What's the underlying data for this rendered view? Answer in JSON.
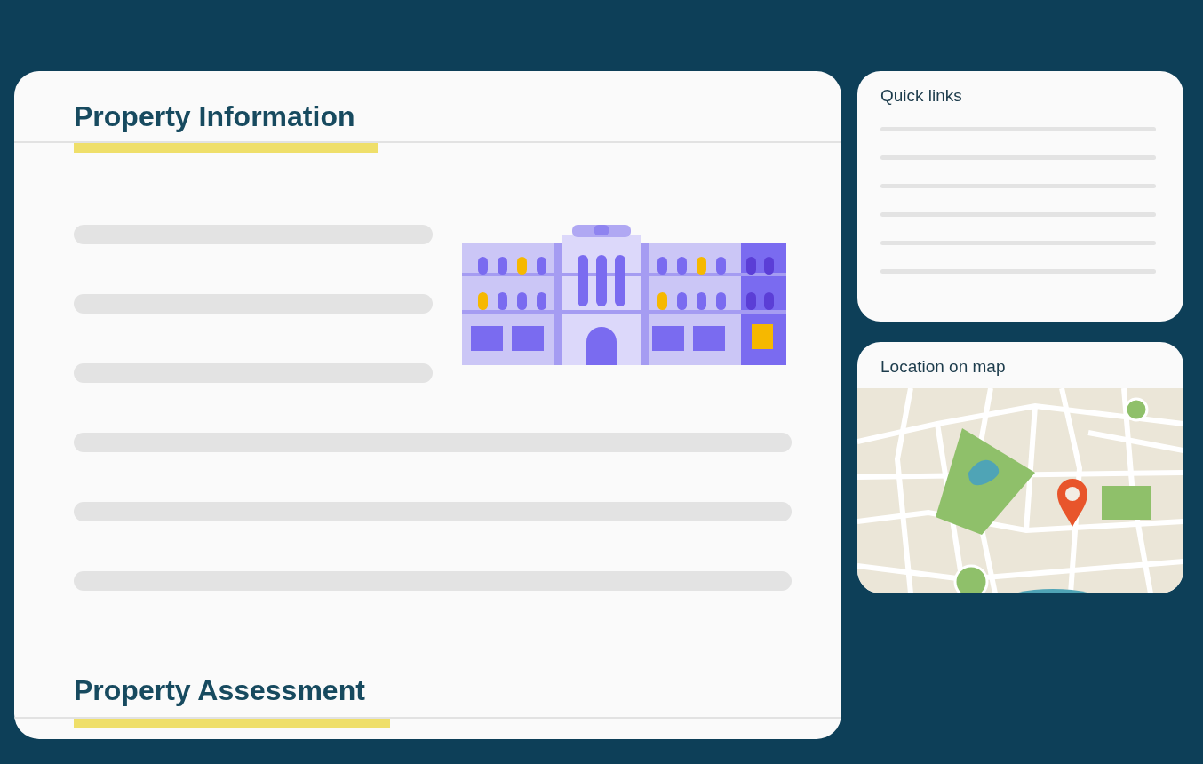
{
  "main_card": {
    "sections": [
      {
        "title": "Property Information"
      },
      {
        "title": "Property Assessment"
      }
    ]
  },
  "quick_links": {
    "title": "Quick links"
  },
  "map_card": {
    "title": "Location on map"
  }
}
